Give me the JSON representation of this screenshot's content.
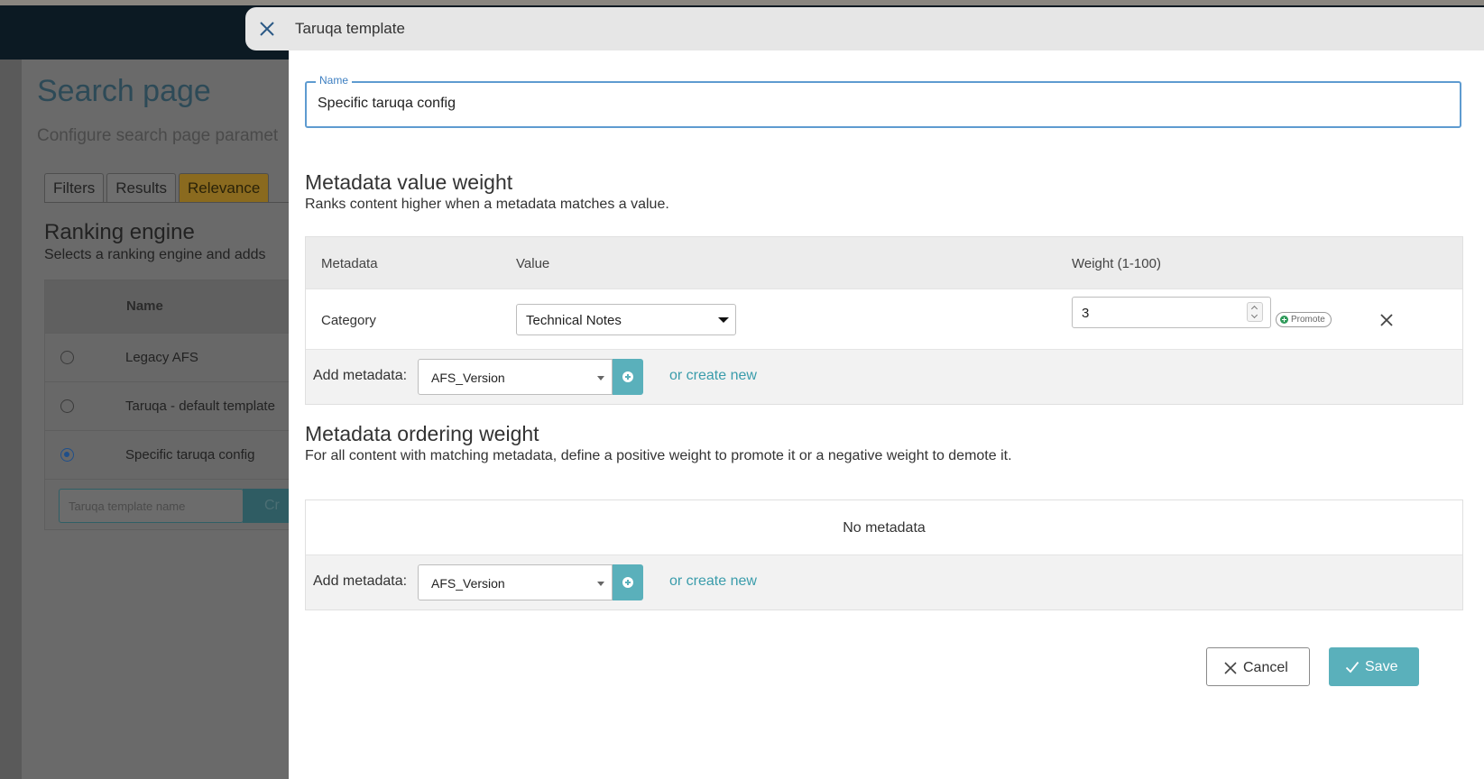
{
  "background": {
    "page_title": "Search page",
    "page_subtitle": "Configure search page paramet",
    "tabs": [
      {
        "label": "Filters"
      },
      {
        "label": "Results"
      },
      {
        "label": "Relevance"
      }
    ],
    "section_title": "Ranking engine",
    "section_desc": "Selects a ranking engine and adds",
    "table_header": "Name",
    "rows": [
      {
        "label": "Legacy AFS",
        "selected": false
      },
      {
        "label": "Taruqa - default template",
        "selected": false
      },
      {
        "label": "Specific taruqa config",
        "selected": true
      }
    ],
    "create_placeholder": "Taruqa template name",
    "create_button": "Cr"
  },
  "panel": {
    "title": "Taruqa template",
    "name_label": "Name",
    "name_value": "Specific taruqa config",
    "value_weight": {
      "title": "Metadata value weight",
      "description": "Ranks content higher when a metadata matches a value.",
      "columns": {
        "metadata": "Metadata",
        "value": "Value",
        "weight": "Weight (1-100)"
      },
      "row": {
        "metadata": "Category",
        "value": "Technical Notes",
        "weight": "3",
        "promote": "Promote"
      },
      "add_label": "Add metadata:",
      "add_select": "AFS_Version",
      "create_link": "or create new"
    },
    "ordering_weight": {
      "title": "Metadata ordering weight",
      "description": "For all content with matching metadata, define a positive weight to promote it or a negative weight to demote it.",
      "empty": "No metadata",
      "add_label": "Add metadata:",
      "add_select": "AFS_Version",
      "create_link": "or create new"
    },
    "cancel_label": "Cancel",
    "save_label": "Save"
  },
  "colors": {
    "accent": "#5ab0bb",
    "link": "#3a9cab",
    "focus_border": "#5e9bd0",
    "header_dark": "#0c1a23"
  }
}
